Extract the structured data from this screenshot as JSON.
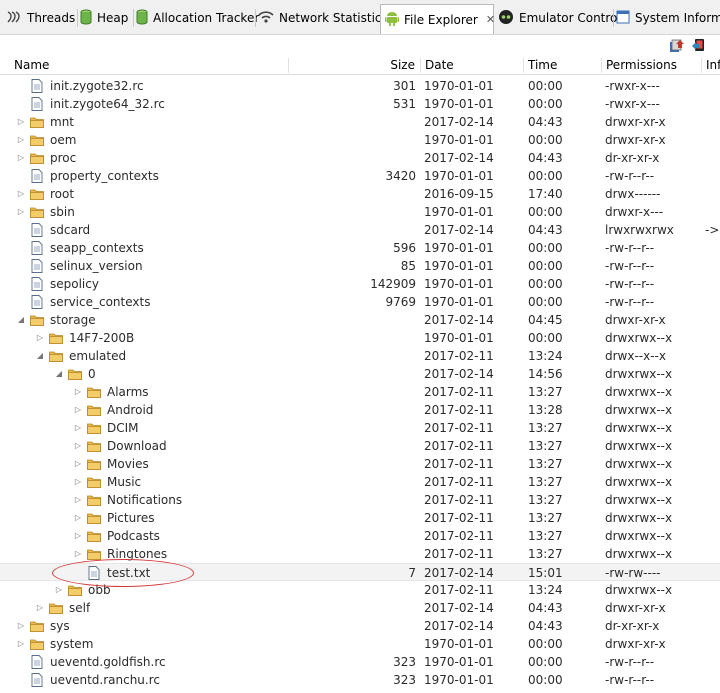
{
  "tabs": [
    {
      "label": "Threads",
      "icon": "threads-icon"
    },
    {
      "label": "Heap",
      "icon": "heap-icon"
    },
    {
      "label": "Allocation Tracker",
      "icon": "allocation-icon"
    },
    {
      "label": "Network Statistics",
      "icon": "wifi-icon"
    },
    {
      "label": "File Explorer",
      "icon": "android-icon",
      "active": true,
      "close": "✕"
    },
    {
      "label": "Emulator Control",
      "icon": "emulator-icon"
    },
    {
      "label": "System Informa",
      "icon": "window-icon"
    }
  ],
  "toolbar": {
    "buttons": [
      {
        "icon": "pull-file-icon"
      },
      {
        "icon": "push-file-icon"
      }
    ]
  },
  "columns": {
    "name": "Name",
    "size": "Size",
    "date": "Date",
    "time": "Time",
    "permissions": "Permissions",
    "info": "Inf"
  },
  "rows": [
    {
      "name": "init.zygote32.rc",
      "type": "file",
      "depth": 0,
      "size": "301",
      "date": "1970-01-01",
      "time": "00:00",
      "perm": "-rwxr-x---",
      "info": ""
    },
    {
      "name": "init.zygote64_32.rc",
      "type": "file",
      "depth": 0,
      "size": "531",
      "date": "1970-01-01",
      "time": "00:00",
      "perm": "-rwxr-x---",
      "info": ""
    },
    {
      "name": "mnt",
      "type": "folder",
      "depth": 0,
      "expand": "collapsed",
      "size": "",
      "date": "2017-02-14",
      "time": "04:43",
      "perm": "drwxr-xr-x",
      "info": ""
    },
    {
      "name": "oem",
      "type": "folder",
      "depth": 0,
      "expand": "collapsed",
      "size": "",
      "date": "1970-01-01",
      "time": "00:00",
      "perm": "drwxr-xr-x",
      "info": ""
    },
    {
      "name": "proc",
      "type": "folder",
      "depth": 0,
      "expand": "collapsed",
      "size": "",
      "date": "2017-02-14",
      "time": "04:43",
      "perm": "dr-xr-xr-x",
      "info": ""
    },
    {
      "name": "property_contexts",
      "type": "file",
      "depth": 0,
      "size": "3420",
      "date": "1970-01-01",
      "time": "00:00",
      "perm": "-rw-r--r--",
      "info": ""
    },
    {
      "name": "root",
      "type": "folder",
      "depth": 0,
      "expand": "collapsed",
      "size": "",
      "date": "2016-09-15",
      "time": "17:40",
      "perm": "drwx------",
      "info": ""
    },
    {
      "name": "sbin",
      "type": "folder",
      "depth": 0,
      "expand": "collapsed",
      "size": "",
      "date": "1970-01-01",
      "time": "00:00",
      "perm": "drwxr-x---",
      "info": ""
    },
    {
      "name": "sdcard",
      "type": "file",
      "depth": 0,
      "size": "",
      "date": "2017-02-14",
      "time": "04:43",
      "perm": "lrwxrwxrwx",
      "info": "->"
    },
    {
      "name": "seapp_contexts",
      "type": "file",
      "depth": 0,
      "size": "596",
      "date": "1970-01-01",
      "time": "00:00",
      "perm": "-rw-r--r--",
      "info": ""
    },
    {
      "name": "selinux_version",
      "type": "file",
      "depth": 0,
      "size": "85",
      "date": "1970-01-01",
      "time": "00:00",
      "perm": "-rw-r--r--",
      "info": ""
    },
    {
      "name": "sepolicy",
      "type": "file",
      "depth": 0,
      "size": "142909",
      "date": "1970-01-01",
      "time": "00:00",
      "perm": "-rw-r--r--",
      "info": ""
    },
    {
      "name": "service_contexts",
      "type": "file",
      "depth": 0,
      "size": "9769",
      "date": "1970-01-01",
      "time": "00:00",
      "perm": "-rw-r--r--",
      "info": ""
    },
    {
      "name": "storage",
      "type": "folder",
      "depth": 0,
      "expand": "expanded",
      "size": "",
      "date": "2017-02-14",
      "time": "04:45",
      "perm": "drwxr-xr-x",
      "info": ""
    },
    {
      "name": "14F7-200B",
      "type": "folder",
      "depth": 1,
      "expand": "collapsed",
      "size": "",
      "date": "1970-01-01",
      "time": "00:00",
      "perm": "drwxrwx--x",
      "info": ""
    },
    {
      "name": "emulated",
      "type": "folder",
      "depth": 1,
      "expand": "expanded",
      "size": "",
      "date": "2017-02-11",
      "time": "13:24",
      "perm": "drwx--x--x",
      "info": ""
    },
    {
      "name": "0",
      "type": "folder",
      "depth": 2,
      "expand": "expanded",
      "size": "",
      "date": "2017-02-14",
      "time": "14:56",
      "perm": "drwxrwx--x",
      "info": ""
    },
    {
      "name": "Alarms",
      "type": "folder",
      "depth": 3,
      "expand": "collapsed",
      "size": "",
      "date": "2017-02-11",
      "time": "13:27",
      "perm": "drwxrwx--x",
      "info": ""
    },
    {
      "name": "Android",
      "type": "folder",
      "depth": 3,
      "expand": "collapsed",
      "size": "",
      "date": "2017-02-11",
      "time": "13:28",
      "perm": "drwxrwx--x",
      "info": ""
    },
    {
      "name": "DCIM",
      "type": "folder",
      "depth": 3,
      "expand": "collapsed",
      "size": "",
      "date": "2017-02-11",
      "time": "13:27",
      "perm": "drwxrwx--x",
      "info": ""
    },
    {
      "name": "Download",
      "type": "folder",
      "depth": 3,
      "expand": "collapsed",
      "size": "",
      "date": "2017-02-11",
      "time": "13:27",
      "perm": "drwxrwx--x",
      "info": ""
    },
    {
      "name": "Movies",
      "type": "folder",
      "depth": 3,
      "expand": "collapsed",
      "size": "",
      "date": "2017-02-11",
      "time": "13:27",
      "perm": "drwxrwx--x",
      "info": ""
    },
    {
      "name": "Music",
      "type": "folder",
      "depth": 3,
      "expand": "collapsed",
      "size": "",
      "date": "2017-02-11",
      "time": "13:27",
      "perm": "drwxrwx--x",
      "info": ""
    },
    {
      "name": "Notifications",
      "type": "folder",
      "depth": 3,
      "expand": "collapsed",
      "size": "",
      "date": "2017-02-11",
      "time": "13:27",
      "perm": "drwxrwx--x",
      "info": ""
    },
    {
      "name": "Pictures",
      "type": "folder",
      "depth": 3,
      "expand": "collapsed",
      "size": "",
      "date": "2017-02-11",
      "time": "13:27",
      "perm": "drwxrwx--x",
      "info": ""
    },
    {
      "name": "Podcasts",
      "type": "folder",
      "depth": 3,
      "expand": "collapsed",
      "size": "",
      "date": "2017-02-11",
      "time": "13:27",
      "perm": "drwxrwx--x",
      "info": ""
    },
    {
      "name": "Ringtones",
      "type": "folder",
      "depth": 3,
      "expand": "collapsed",
      "size": "",
      "date": "2017-02-11",
      "time": "13:27",
      "perm": "drwxrwx--x",
      "info": ""
    },
    {
      "name": "test.txt",
      "type": "file",
      "depth": 3,
      "size": "7",
      "date": "2017-02-14",
      "time": "15:01",
      "perm": "-rw-rw----",
      "info": "",
      "selected": true
    },
    {
      "name": "obb",
      "type": "folder",
      "depth": 2,
      "expand": "collapsed",
      "size": "",
      "date": "2017-02-11",
      "time": "13:24",
      "perm": "drwxrwx--x",
      "info": ""
    },
    {
      "name": "self",
      "type": "folder",
      "depth": 1,
      "expand": "collapsed",
      "size": "",
      "date": "2017-02-14",
      "time": "04:43",
      "perm": "drwxr-xr-x",
      "info": ""
    },
    {
      "name": "sys",
      "type": "folder",
      "depth": 0,
      "expand": "collapsed",
      "size": "",
      "date": "2017-02-14",
      "time": "04:43",
      "perm": "dr-xr-xr-x",
      "info": ""
    },
    {
      "name": "system",
      "type": "folder",
      "depth": 0,
      "expand": "collapsed",
      "size": "",
      "date": "1970-01-01",
      "time": "00:00",
      "perm": "drwxr-xr-x",
      "info": ""
    },
    {
      "name": "ueventd.goldfish.rc",
      "type": "file",
      "depth": 0,
      "size": "323",
      "date": "1970-01-01",
      "time": "00:00",
      "perm": "-rw-r--r--",
      "info": ""
    },
    {
      "name": "ueventd.ranchu.rc",
      "type": "file",
      "depth": 0,
      "size": "323",
      "date": "1970-01-01",
      "time": "00:00",
      "perm": "-rw-r--r--",
      "info": ""
    }
  ],
  "colors": {
    "folder": "#e8b94a",
    "folder_edge": "#b9862a",
    "android": "#8fbf3f",
    "highlight": "#d43a3a"
  }
}
